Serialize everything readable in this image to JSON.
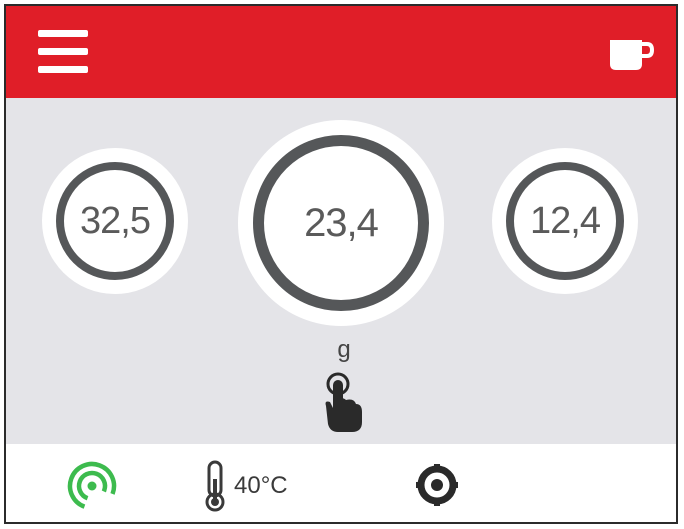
{
  "header": {
    "menu_icon": "hamburger-menu-icon",
    "cup_icon": "coffee-cup-icon"
  },
  "doses": [
    {
      "value": "32,5"
    },
    {
      "value": "23,4",
      "selected": true
    },
    {
      "value": "12,4"
    }
  ],
  "unit_label": "g",
  "hint_icon": "tap-hand-icon",
  "footer": {
    "wifi_icon": "wifi-connected-icon",
    "wifi_color": "#3dbb4e",
    "temperature": "40°C",
    "settings_icon": "settings-ring-icon"
  },
  "colors": {
    "header_bg": "#e01e28",
    "main_bg": "#e4e4e8",
    "ring": "#555759"
  }
}
